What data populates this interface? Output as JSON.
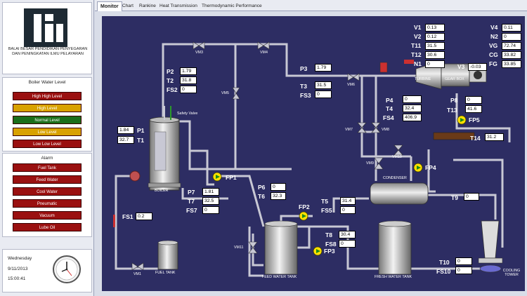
{
  "org": {
    "name": "BALAI BESAR PENDIDIKAN PENYEGARAN DAN PENINGKATAN ILMU PELAYARAN"
  },
  "boiler_water_level": {
    "title": "Boiler Water Level",
    "items": [
      "High High Level",
      "High Level",
      "Normal Level",
      "Low Level",
      "Low Low Level"
    ]
  },
  "alarm": {
    "title": "Alarm",
    "items": [
      "Fuel Tank",
      "Feed Water",
      "Cool Water",
      "Pneumatic",
      "Vacuum",
      "Lube Oil"
    ]
  },
  "clock": {
    "day": "Wednesday",
    "date": "9/11/2013",
    "time": "15:00:41"
  },
  "tabs": [
    "Monitor",
    "Chart",
    "Rankine",
    "Heat Transmission",
    "Thermodynamic Performance"
  ],
  "diagram": {
    "components": {
      "boiler": "BOILER",
      "turbine": "TURBINE",
      "gearbox": "GEAR BOX",
      "condenser": "CONDENSER",
      "fuel_tank": "FUEL TANK",
      "feed_water_tank": "FEED WATER TANK",
      "fresh_water_tank": "FRESH WATER TANK",
      "cooling_tower": "COOLING TOWER",
      "safety_valve": "Safety Valve"
    },
    "valves": {
      "vm1": "VM1",
      "vm3": "VM3",
      "vm4": "VM4",
      "vm5": "VM5",
      "vm6": "VM6",
      "vm7": "VM7",
      "vm8": "VM8",
      "vm9": "VM9",
      "vm10": "VM10",
      "vm11": "VM11"
    },
    "pumps": {
      "fp1": "FP1",
      "fp2": "FP2",
      "fp3": "FP3",
      "fp4": "FP4",
      "fp5": "FP5"
    },
    "readings": {
      "v1": {
        "label": "V1",
        "value": "0.13"
      },
      "v2": {
        "label": "V2",
        "value": "0.12"
      },
      "t11": {
        "label": "T11",
        "value": "31.5"
      },
      "t12": {
        "label": "T12",
        "value": "30.6"
      },
      "n1": {
        "label": "N1",
        "value": "0"
      },
      "v3": {
        "label": "V3",
        "value": "-0.03"
      },
      "v4": {
        "label": "V4",
        "value": "0.11"
      },
      "n2": {
        "label": "N2",
        "value": "0"
      },
      "vg": {
        "label": "VG",
        "value": "72.74"
      },
      "cg": {
        "label": "CG",
        "value": "33.82"
      },
      "fg": {
        "label": "FG",
        "value": "33.85"
      },
      "p2": {
        "label": "P2",
        "value": "1.79"
      },
      "t2": {
        "label": "T2",
        "value": "31.8"
      },
      "fs2": {
        "label": "FS2",
        "value": "0"
      },
      "p3": {
        "label": "P3",
        "value": "1.79"
      },
      "t3": {
        "label": "T3",
        "value": "31.5"
      },
      "fs3": {
        "label": "FS3",
        "value": "0"
      },
      "p4": {
        "label": "P4",
        "value": "0"
      },
      "t4": {
        "label": "T4",
        "value": "32.4"
      },
      "fs4": {
        "label": "FS4",
        "value": "406.9"
      },
      "p8": {
        "label": "P8",
        "value": "0"
      },
      "t13": {
        "label": "T13",
        "value": "41.6"
      },
      "t14": {
        "label": "T14",
        "value": "31.2"
      },
      "p1": {
        "label": "P1",
        "value": "1.84"
      },
      "t1": {
        "label": "T1",
        "value": "32.7"
      },
      "p7": {
        "label": "P7",
        "value": "1.81"
      },
      "t7": {
        "label": "T7",
        "value": "32.5"
      },
      "fs7": {
        "label": "FS7",
        "value": "0"
      },
      "p6": {
        "label": "P6",
        "value": "0"
      },
      "t6": {
        "label": "T6",
        "value": "32.3"
      },
      "t5": {
        "label": "T5",
        "value": "31.4"
      },
      "fs5": {
        "label": "FS5",
        "value": "0"
      },
      "t9": {
        "label": "T9",
        "value": "0"
      },
      "fs1": {
        "label": "FS1",
        "value": "0.2"
      },
      "t8": {
        "label": "T8",
        "value": "30.4"
      },
      "fs8": {
        "label": "FS8",
        "value": "0"
      },
      "t10": {
        "label": "T10",
        "value": "0"
      },
      "fs10": {
        "label": "FS10",
        "value": "0"
      }
    }
  },
  "colors": {
    "background": "#2d2d63",
    "pipe": "#c8c8d4",
    "pump": "#ffe000",
    "alarm": "#9a1010",
    "warning": "#d8a200",
    "normal": "#1a6e1a"
  }
}
